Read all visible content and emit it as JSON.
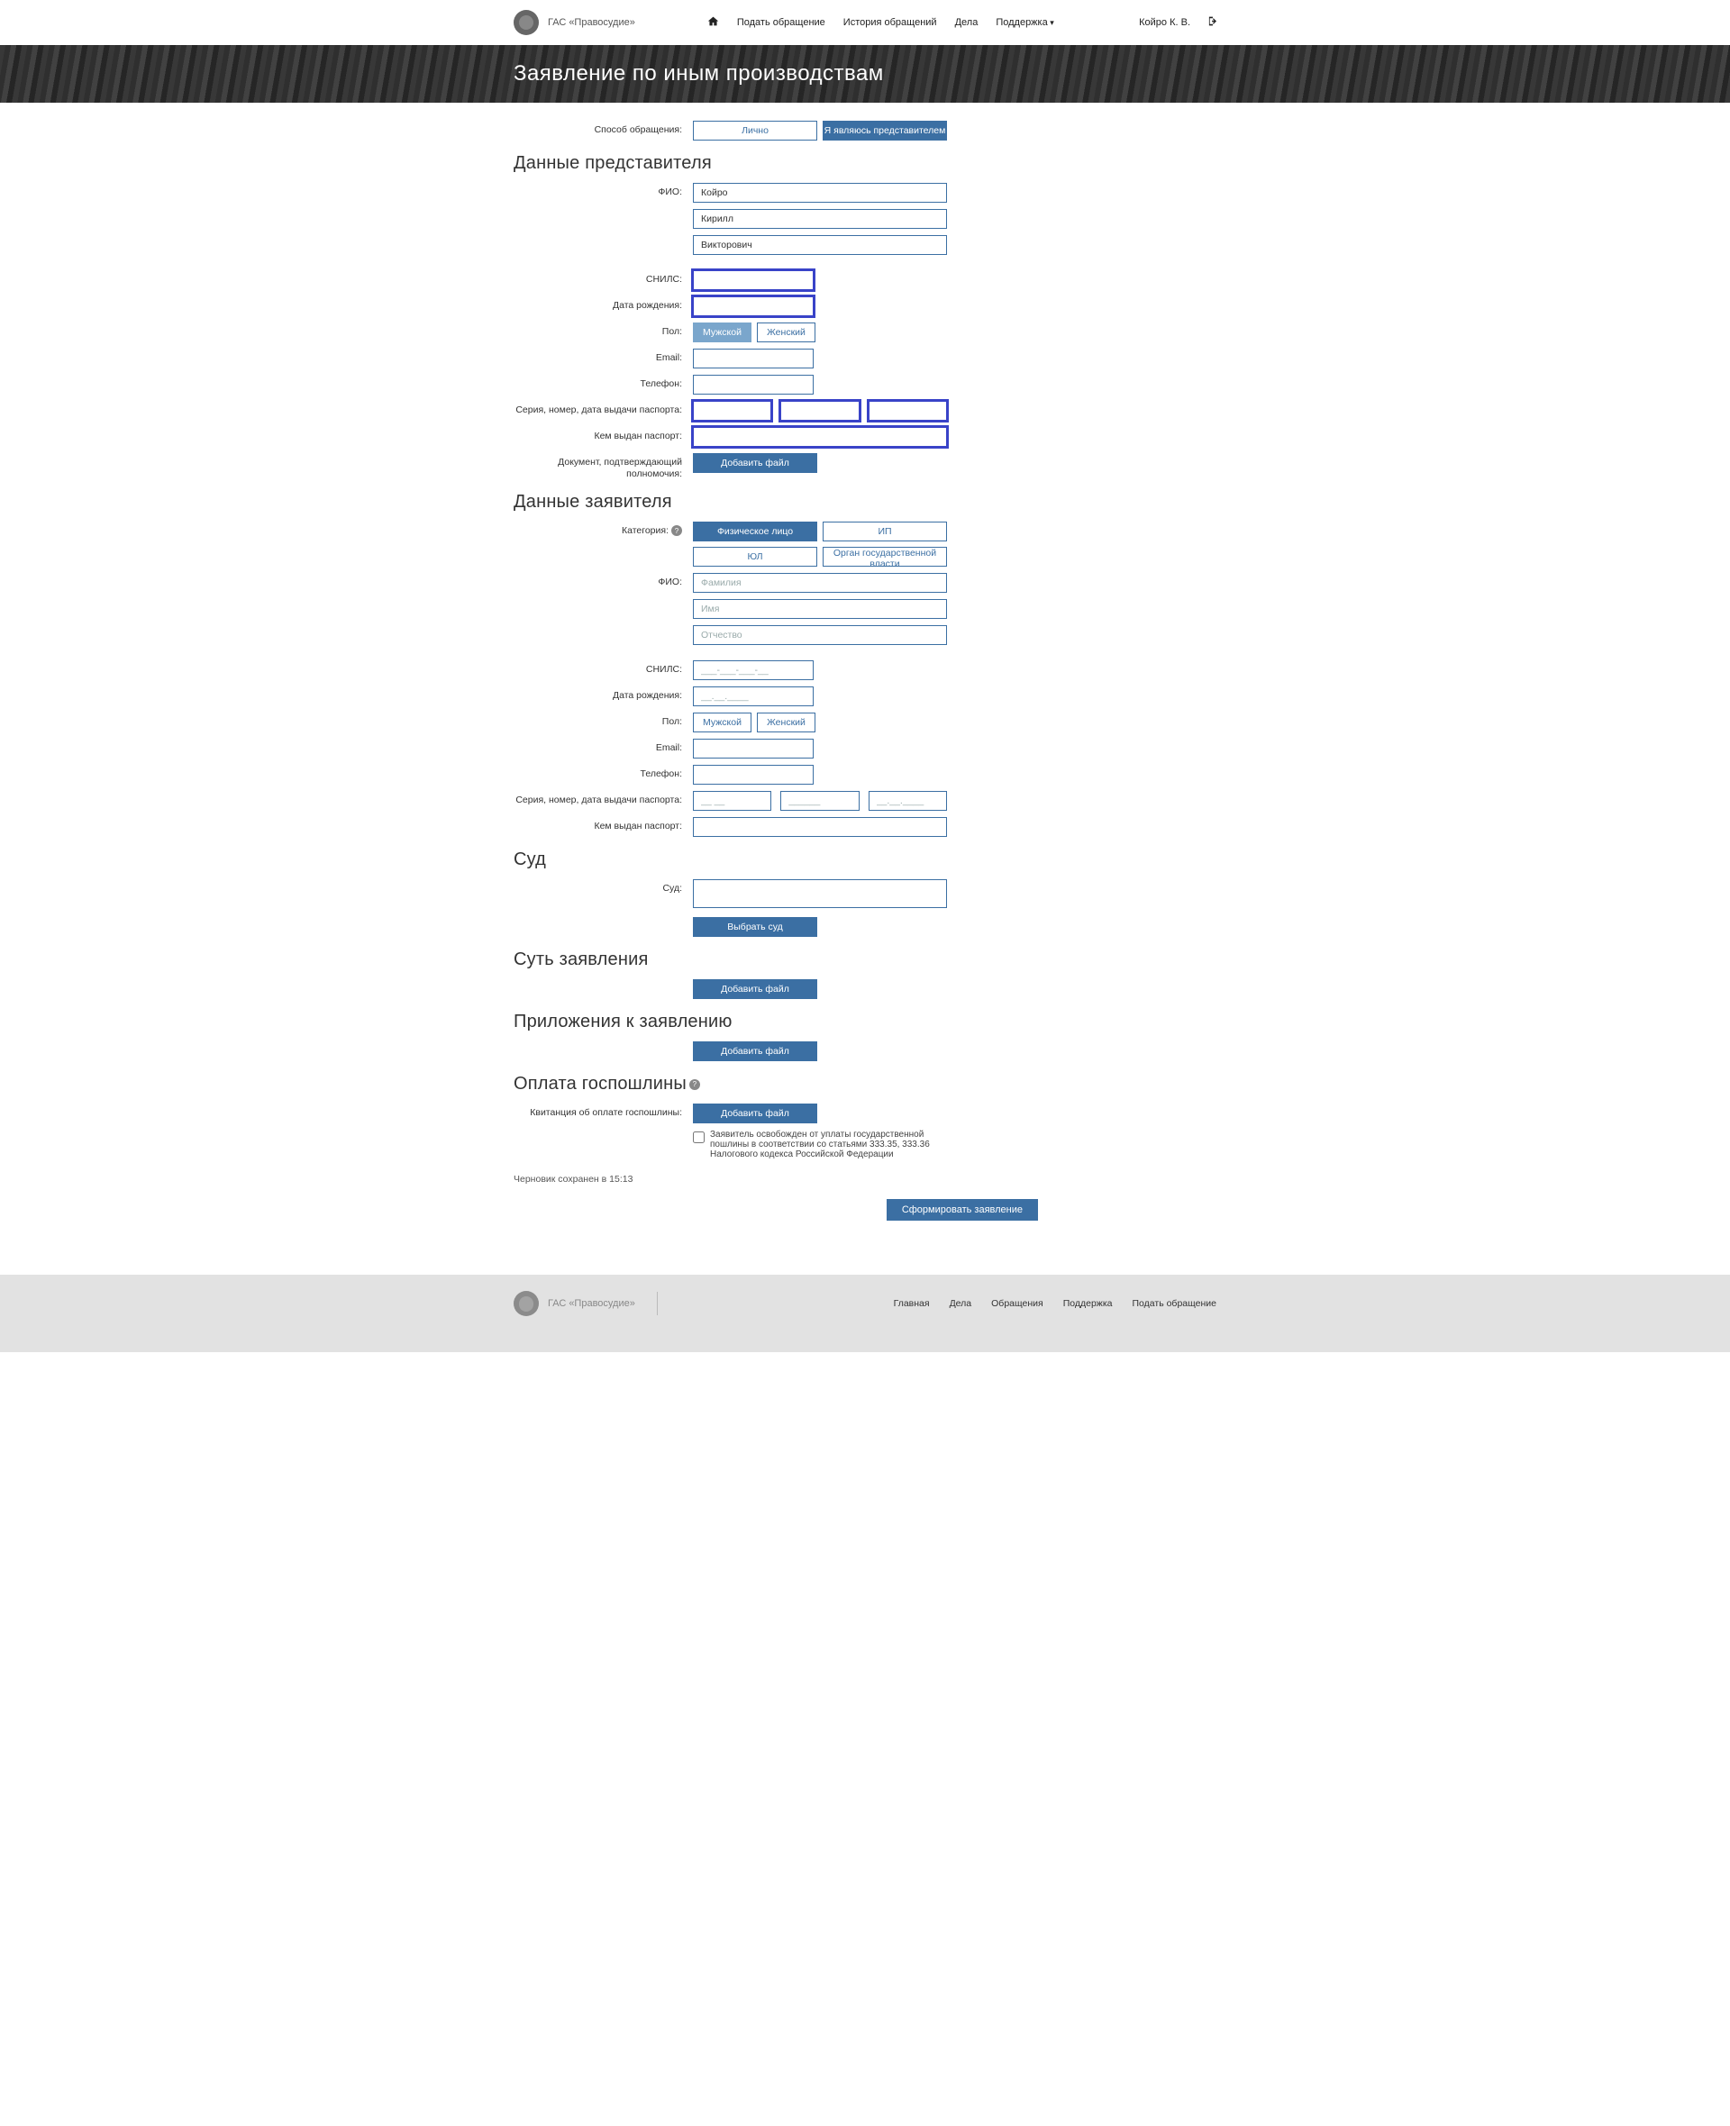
{
  "site": {
    "name": "ГАС «Правосудие»"
  },
  "nav": {
    "submit": "Подать обращение",
    "history": "История обращений",
    "cases": "Дела",
    "support": "Поддержка"
  },
  "user": {
    "name": "Койро К. В."
  },
  "banner": {
    "title": "Заявление по иным производствам"
  },
  "labels": {
    "method": "Cпособ обращения:",
    "fio": "ФИО:",
    "snils": "СНИЛС:",
    "dob": "Дата рождения:",
    "gender": "Пол:",
    "email": "Email:",
    "phone": "Телефон:",
    "passport_snd": "Серия, номер, дата выдачи паспорта:",
    "passport_by": "Кем выдан паспорт:",
    "authority_doc": "Документ, подтверждающий полномочия:",
    "category": "Категория:",
    "court": "Суд:",
    "receipt": "Квитанция об оплате госпошлины:"
  },
  "method": {
    "personal": "Лично",
    "rep": "Я являюсь представителем"
  },
  "gender": {
    "male": "Мужской",
    "female": "Женский"
  },
  "placeholders": {
    "surname": "Фамилия",
    "name": "Имя",
    "patronymic": "Отчество",
    "snils": "___-___-___-__",
    "date": "__.__.____",
    "pass_s": "__ __",
    "pass_n": "______",
    "pass_d": "__.__.____"
  },
  "sections": {
    "rep": "Данные представителя",
    "applicant": "Данные заявителя",
    "court": "Суд",
    "essence": "Суть заявления",
    "attachments": "Приложения к заявлению",
    "fee": "Оплата госпошлины"
  },
  "rep": {
    "surname": "Койро",
    "name": "Кирилл",
    "patronymic": "Викторович",
    "snils": "",
    "dob": "",
    "email": "",
    "phone": "",
    "pass_s": "",
    "pass_n": "",
    "pass_d": "",
    "pass_by": ""
  },
  "category": {
    "individual": "Физическое лицо",
    "ip": "ИП",
    "legal": "ЮЛ",
    "gov": "Орган государственной власти"
  },
  "buttons": {
    "add_file": "Добавить файл",
    "choose_court": "Выбрать суд",
    "submit": "Сформировать заявление"
  },
  "fee_exempt": "Заявитель освобожден от уплаты государственной пошлины в соответствии со статьями 333.35, 333.36 Налогового кодекса Российской Федерации",
  "draft_saved": "Черновик сохранен в 15:13",
  "footer": {
    "home": "Главная",
    "cases": "Дела",
    "appeals": "Обращения",
    "support": "Поддержка",
    "submit": "Подать обращение"
  }
}
